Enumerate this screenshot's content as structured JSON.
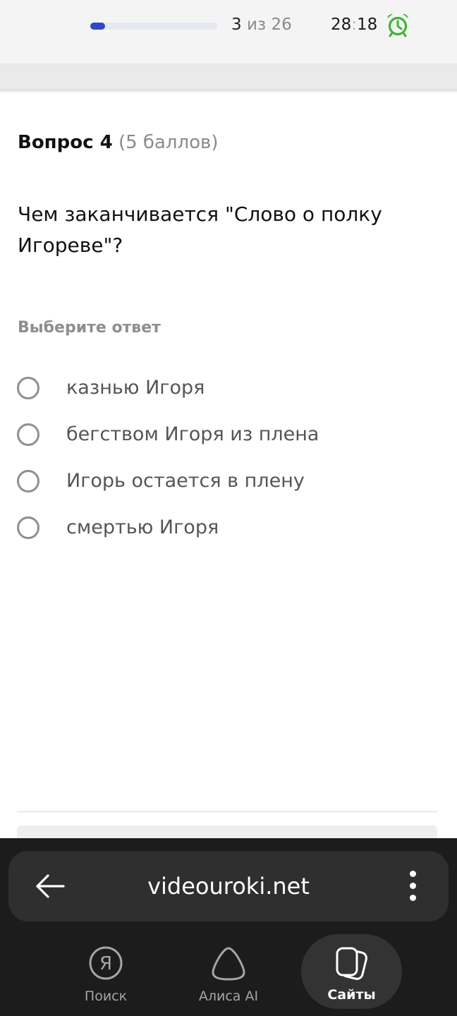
{
  "progress": {
    "current": "3",
    "separator": "из",
    "total": "26",
    "fraction": 0.1154,
    "fill_color": "#2f49c4"
  },
  "timer": {
    "minutes": "28",
    "separator": ":",
    "seconds": "18",
    "icon": "alarm-clock-icon",
    "icon_color": "#3fb52f"
  },
  "question": {
    "title": "Вопрос 4",
    "points": "(5 баллов)",
    "text": "Чем заканчивается \"Слово о полку Игореве\"?",
    "instruction": "Выберите ответ"
  },
  "answers": [
    {
      "label": "казнью Игоря",
      "selected": false
    },
    {
      "label": "бегством Игоря из плена",
      "selected": false
    },
    {
      "label": "Игорь остается в плену",
      "selected": false
    },
    {
      "label": "смертью Игоря",
      "selected": false
    }
  ],
  "browser": {
    "url": "videouroki.net",
    "back_icon": "arrow-left-icon",
    "menu_icon": "vertical-dots-icon",
    "nav": [
      {
        "label": "Поиск",
        "icon": "yandex-search-icon",
        "active": false
      },
      {
        "label": "Алиса AI",
        "icon": "alice-icon",
        "active": false
      },
      {
        "label": "Сайты",
        "icon": "tabs-icon",
        "active": true
      }
    ]
  }
}
